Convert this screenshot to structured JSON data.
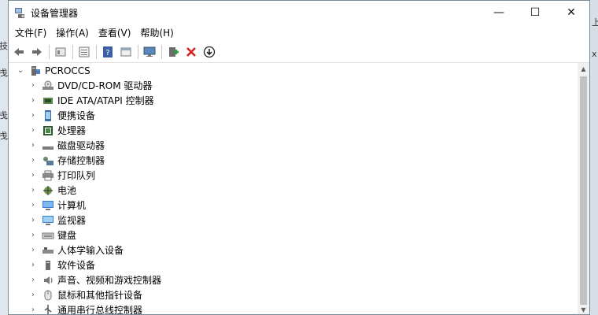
{
  "window": {
    "title": "设备管理器",
    "minimize": "—",
    "maximize": "☐",
    "close": "✕"
  },
  "menu": [
    {
      "name": "menu-file",
      "label": "文件(F)"
    },
    {
      "name": "menu-action",
      "label": "操作(A)"
    },
    {
      "name": "menu-view",
      "label": "查看(V)"
    },
    {
      "name": "menu-help",
      "label": "帮助(H)"
    }
  ],
  "toolbar_icons": [
    "back-arrow-icon",
    "forward-arrow-icon",
    "properties-icon",
    "list-view-icon",
    "help-icon",
    "panel-icon",
    "monitor-scan-icon",
    "add-driver-icon",
    "uninstall-x-icon",
    "update-driver-icon"
  ],
  "tree": {
    "root": "PCROCCS",
    "items": [
      {
        "label": "DVD/CD-ROM 驱动器",
        "icon": "dvd-icon"
      },
      {
        "label": "IDE ATA/ATAPI 控制器",
        "icon": "ide-controller-icon"
      },
      {
        "label": "便携设备",
        "icon": "portable-device-icon"
      },
      {
        "label": "处理器",
        "icon": "processor-icon"
      },
      {
        "label": "磁盘驱动器",
        "icon": "disk-drive-icon"
      },
      {
        "label": "存储控制器",
        "icon": "storage-controller-icon"
      },
      {
        "label": "打印队列",
        "icon": "printer-icon"
      },
      {
        "label": "电池",
        "icon": "battery-icon"
      },
      {
        "label": "计算机",
        "icon": "computer-icon"
      },
      {
        "label": "监视器",
        "icon": "monitor-icon"
      },
      {
        "label": "键盘",
        "icon": "keyboard-icon"
      },
      {
        "label": "人体学输入设备",
        "icon": "hid-icon"
      },
      {
        "label": "软件设备",
        "icon": "software-device-icon"
      },
      {
        "label": "声音、视频和游戏控制器",
        "icon": "sound-icon"
      },
      {
        "label": "鼠标和其他指针设备",
        "icon": "mouse-icon"
      },
      {
        "label": "通用串行总线控制器",
        "icon": "usb-icon"
      }
    ]
  },
  "background_fragments": {
    "left": [
      "技",
      "戋",
      "戋",
      "戋"
    ],
    "right": [
      "上",
      "x"
    ]
  },
  "colors": {
    "accent_blue": "#3a7bd5",
    "uninstall_red": "#d02020",
    "add_green": "#2e9d3a"
  }
}
